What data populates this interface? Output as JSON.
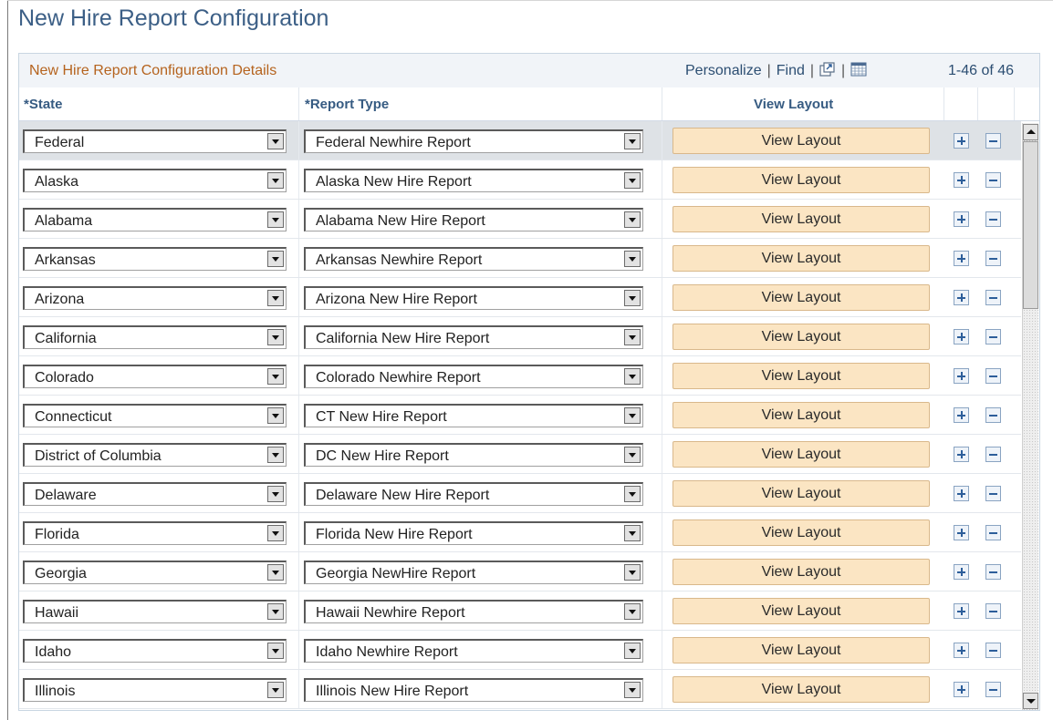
{
  "page": {
    "title": "New Hire Report Configuration"
  },
  "grid": {
    "title": "New Hire Report Configuration Details",
    "personalize": "Personalize",
    "find": "Find",
    "separator": "|",
    "count": "1-46 of 46",
    "columns": {
      "state": "*State",
      "report_type": "*Report Type",
      "view_layout": "View Layout"
    },
    "rows": [
      {
        "state": "Federal",
        "report_type": "Federal Newhire Report",
        "button": "View Layout"
      },
      {
        "state": "Alaska",
        "report_type": "Alaska New Hire Report",
        "button": "View Layout"
      },
      {
        "state": "Alabama",
        "report_type": "Alabama New Hire Report",
        "button": "View Layout"
      },
      {
        "state": "Arkansas",
        "report_type": "Arkansas Newhire Report",
        "button": "View Layout"
      },
      {
        "state": "Arizona",
        "report_type": "Arizona New Hire Report",
        "button": "View Layout"
      },
      {
        "state": "California",
        "report_type": "California New Hire Report",
        "button": "View Layout"
      },
      {
        "state": "Colorado",
        "report_type": "Colorado Newhire Report",
        "button": "View Layout"
      },
      {
        "state": "Connecticut",
        "report_type": "CT New Hire Report",
        "button": "View Layout"
      },
      {
        "state": "District of Columbia",
        "report_type": "DC New Hire Report",
        "button": "View Layout"
      },
      {
        "state": "Delaware",
        "report_type": "Delaware New Hire Report",
        "button": "View Layout"
      },
      {
        "state": "Florida",
        "report_type": "Florida New Hire Report",
        "button": "View Layout"
      },
      {
        "state": "Georgia",
        "report_type": "Georgia NewHire Report",
        "button": "View Layout"
      },
      {
        "state": "Hawaii",
        "report_type": "Hawaii Newhire Report",
        "button": "View Layout"
      },
      {
        "state": "Idaho",
        "report_type": "Idaho Newhire Report",
        "button": "View Layout"
      },
      {
        "state": "Illinois",
        "report_type": "Illinois New Hire Report",
        "button": "View Layout"
      }
    ]
  },
  "colors": {
    "title": "#3c5f86",
    "grid_title": "#b5631e",
    "button_bg": "#fbe5c3",
    "header_text": "#365b82"
  },
  "icons": {
    "zoom": "new-window-icon",
    "download": "spreadsheet-icon",
    "add": "plus-icon",
    "delete": "minus-icon"
  }
}
